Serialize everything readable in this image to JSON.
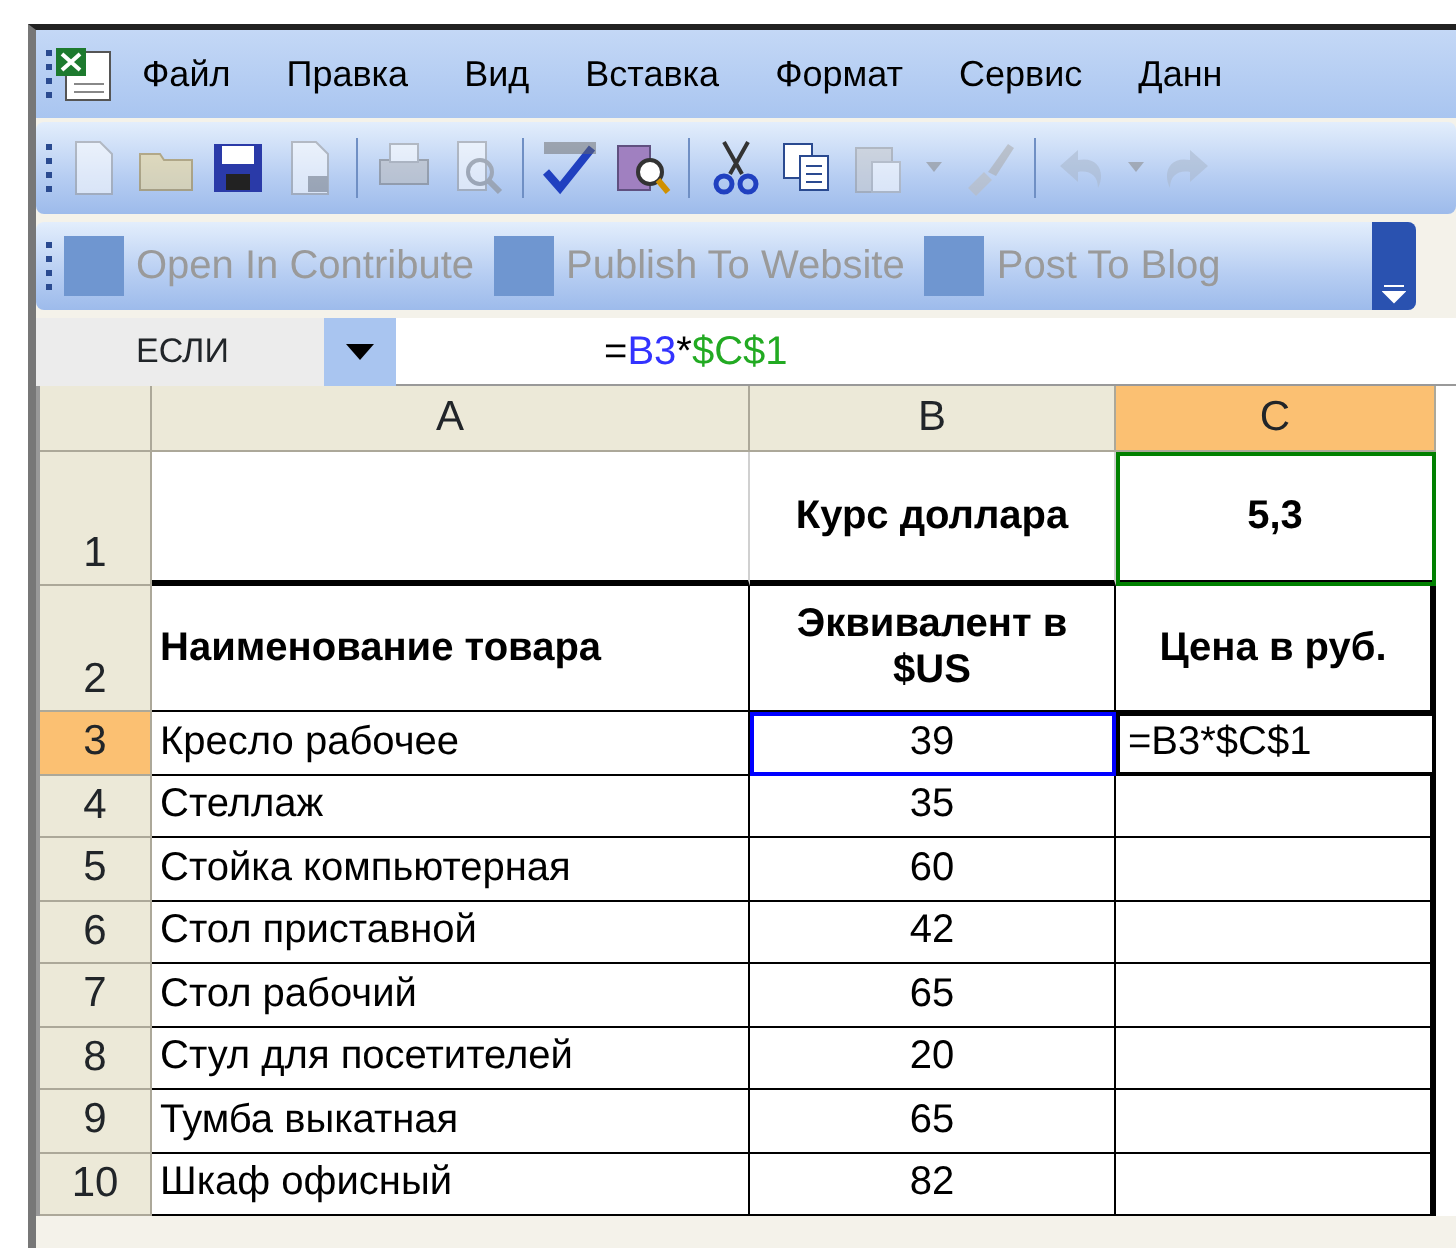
{
  "menu": [
    {
      "label": "Файл"
    },
    {
      "label": "Правка"
    },
    {
      "label": "Вид"
    },
    {
      "label": "Вставка"
    },
    {
      "label": "Формат"
    },
    {
      "label": "Сервис"
    },
    {
      "label": "Данн"
    }
  ],
  "toolbar": [
    {
      "kind": "new",
      "disabled": true
    },
    {
      "kind": "open",
      "disabled": true
    },
    {
      "kind": "save",
      "disabled": false
    },
    {
      "kind": "permission",
      "disabled": true
    },
    {
      "kind": "separator"
    },
    {
      "kind": "print",
      "disabled": true
    },
    {
      "kind": "preview",
      "disabled": true
    },
    {
      "kind": "separator"
    },
    {
      "kind": "spelling",
      "disabled": false
    },
    {
      "kind": "research",
      "disabled": false
    },
    {
      "kind": "separator"
    },
    {
      "kind": "cut",
      "disabled": false
    },
    {
      "kind": "copy",
      "disabled": false
    },
    {
      "kind": "paste",
      "disabled": true
    },
    {
      "kind": "caret",
      "disabled": true
    },
    {
      "kind": "brush",
      "disabled": true
    },
    {
      "kind": "separator"
    },
    {
      "kind": "undo",
      "disabled": true
    },
    {
      "kind": "caret",
      "disabled": true
    },
    {
      "kind": "redo",
      "disabled": true
    }
  ],
  "contribute_toolbar": [
    {
      "label": "Open In Contribute",
      "disabled": true
    },
    {
      "label": "Publish To Website",
      "disabled": true
    },
    {
      "label": "Post To Blog",
      "disabled": true
    }
  ],
  "name_box": {
    "value": "ЕСЛИ"
  },
  "formula_bar": {
    "parts": [
      {
        "text": "=",
        "color": "#000000"
      },
      {
        "text": "B3",
        "color": "#3333ff"
      },
      {
        "text": "*",
        "color": "#000000"
      },
      {
        "text": "$C$1",
        "color": "#22aa22"
      }
    ]
  },
  "sheet": {
    "columns": [
      {
        "label": "A",
        "selected": false
      },
      {
        "label": "B",
        "selected": false
      },
      {
        "label": "C",
        "selected": true
      }
    ],
    "rows": [
      {
        "header": "1",
        "selected": false,
        "bold": true,
        "cells": [
          {
            "text": ""
          },
          {
            "text": "Курс доллара"
          },
          {
            "text": "5,3",
            "color": "#008000"
          }
        ]
      },
      {
        "header": "2",
        "selected": false,
        "bold": true,
        "cells": [
          {
            "text": "Наименование товара"
          },
          {
            "text": "Эквивалент в $US"
          },
          {
            "text": "Цена в руб."
          }
        ]
      },
      {
        "header": "3",
        "selected": true,
        "bold": false,
        "cells": [
          {
            "text": "Кресло рабочее"
          },
          {
            "text": "39",
            "color": "#0000ff"
          },
          {
            "text": "=B3*$C$1",
            "editing": true
          }
        ]
      },
      {
        "header": "4",
        "selected": false,
        "bold": false,
        "cells": [
          {
            "text": "Стеллаж"
          },
          {
            "text": "35"
          },
          {
            "text": ""
          }
        ]
      },
      {
        "header": "5",
        "selected": false,
        "bold": false,
        "cells": [
          {
            "text": "Стойка компьютерная"
          },
          {
            "text": "60"
          },
          {
            "text": ""
          }
        ]
      },
      {
        "header": "6",
        "selected": false,
        "bold": false,
        "cells": [
          {
            "text": "Стол приставной"
          },
          {
            "text": "42"
          },
          {
            "text": ""
          }
        ]
      },
      {
        "header": "7",
        "selected": false,
        "bold": false,
        "cells": [
          {
            "text": "Стол рабочий"
          },
          {
            "text": "65"
          },
          {
            "text": ""
          }
        ]
      },
      {
        "header": "8",
        "selected": false,
        "bold": false,
        "cells": [
          {
            "text": "Стул для посетителей"
          },
          {
            "text": "20"
          },
          {
            "text": ""
          }
        ]
      },
      {
        "header": "9",
        "selected": false,
        "bold": false,
        "cells": [
          {
            "text": "Тумба выкатная"
          },
          {
            "text": "65"
          },
          {
            "text": ""
          }
        ]
      },
      {
        "header": "10",
        "selected": false,
        "bold": false,
        "cells": [
          {
            "text": "Шкаф офисный"
          },
          {
            "text": "82"
          },
          {
            "text": ""
          }
        ]
      }
    ]
  }
}
